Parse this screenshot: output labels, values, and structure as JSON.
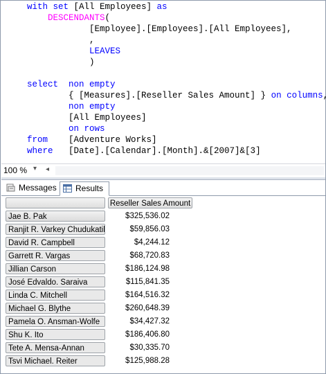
{
  "editor": {
    "lines": [
      "with set [All Employees] as",
      "    DESCENDANTS(",
      "                [Employee].[Employees].[All Employees],",
      "                ,",
      "                LEAVES",
      "                )",
      "",
      "select  non empty",
      "        { [Measures].[Reseller Sales Amount] } on columns,",
      "        non empty",
      "        [All Employees]",
      "        on rows",
      "from    [Adventure Works]",
      "where   [Date].[Calendar].[Month].&[2007]&[3]"
    ]
  },
  "zoom": {
    "value": "100 %"
  },
  "tabs": {
    "messages": "Messages",
    "results": "Results"
  },
  "grid": {
    "column_header": "Reseller Sales Amount",
    "rows": [
      {
        "name": "Jae B. Pak",
        "value": "$325,536.02"
      },
      {
        "name": "Ranjit R. Varkey Chudukatil",
        "value": "$59,856.03"
      },
      {
        "name": "David R. Campbell",
        "value": "$4,244.12"
      },
      {
        "name": "Garrett R. Vargas",
        "value": "$68,720.83"
      },
      {
        "name": "Jillian Carson",
        "value": "$186,124.98"
      },
      {
        "name": "José Edvaldo. Saraiva",
        "value": "$115,841.35"
      },
      {
        "name": "Linda C. Mitchell",
        "value": "$164,516.32"
      },
      {
        "name": "Michael G. Blythe",
        "value": "$260,648.39"
      },
      {
        "name": "Pamela O. Ansman-Wolfe",
        "value": "$34,427.32"
      },
      {
        "name": "Shu K. Ito",
        "value": "$186,406.80"
      },
      {
        "name": "Tete A. Mensa-Annan",
        "value": "$30,335.70"
      },
      {
        "name": "Tsvi Michael. Reiter",
        "value": "$125,988.28"
      }
    ]
  }
}
